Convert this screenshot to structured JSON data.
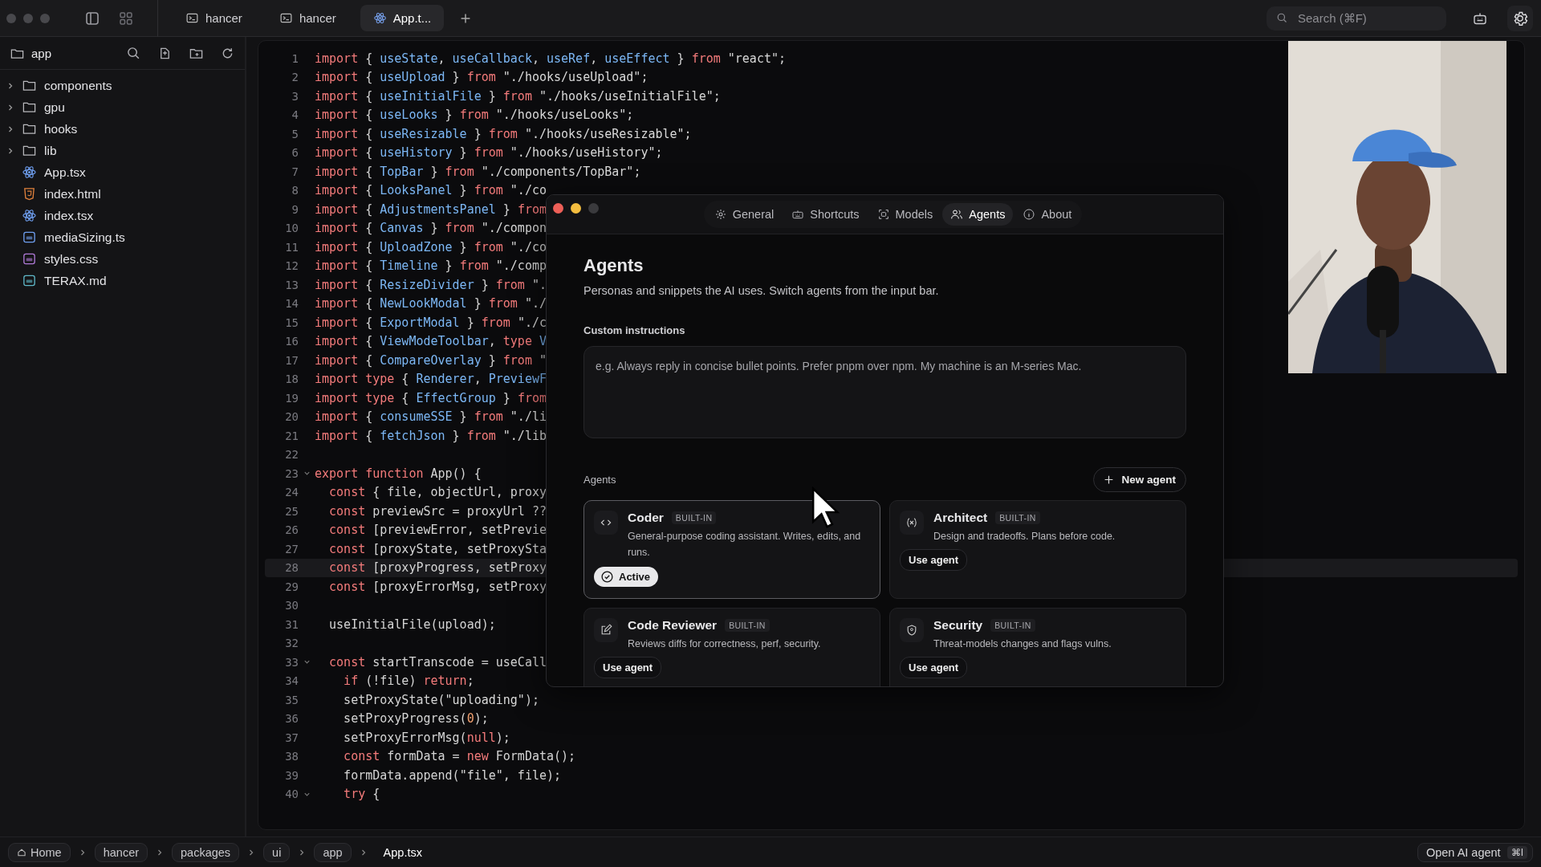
{
  "window": {
    "tabs": [
      {
        "label": "hancer",
        "kind": "terminal",
        "selected": false
      },
      {
        "label": "hancer",
        "kind": "terminal",
        "selected": false
      },
      {
        "label": "App.t...",
        "kind": "react",
        "selected": true
      }
    ],
    "search": {
      "placeholder": "Search (⌘F)"
    }
  },
  "sidebar": {
    "title": "app",
    "items": [
      {
        "name": "components",
        "kind": "folder",
        "expanded": false
      },
      {
        "name": "gpu",
        "kind": "folder",
        "expanded": false
      },
      {
        "name": "hooks",
        "kind": "folder",
        "expanded": false
      },
      {
        "name": "lib",
        "kind": "folder",
        "expanded": false
      },
      {
        "name": "App.tsx",
        "kind": "react"
      },
      {
        "name": "index.html",
        "kind": "html"
      },
      {
        "name": "index.tsx",
        "kind": "react"
      },
      {
        "name": "mediaSizing.ts",
        "kind": "ts"
      },
      {
        "name": "styles.css",
        "kind": "css"
      },
      {
        "name": "TERAX.md",
        "kind": "md"
      }
    ]
  },
  "editor": {
    "lines": [
      {
        "n": "1",
        "fold": false,
        "current": false,
        "seg": [
          {
            "keyword": "import"
          },
          {
            "plain": " { "
          },
          {
            "name": "useState"
          },
          {
            "plain": ", "
          },
          {
            "name": "useCallback"
          },
          {
            "plain": ", "
          },
          {
            "name": "useRef"
          },
          {
            "plain": ", "
          },
          {
            "name": "useEffect"
          },
          {
            "plain": " } "
          },
          {
            "keyword": "from "
          },
          {
            "string": "\"react\""
          },
          {
            "plain": ";"
          }
        ]
      },
      {
        "n": "2",
        "fold": false,
        "current": false,
        "seg": [
          {
            "keyword": "import"
          },
          {
            "plain": " { "
          },
          {
            "name": "useUpload"
          },
          {
            "plain": " } "
          },
          {
            "keyword": "from "
          },
          {
            "string": "\"./hooks/useUpload\""
          },
          {
            "plain": ";"
          }
        ]
      },
      {
        "n": "3",
        "fold": false,
        "current": false,
        "seg": [
          {
            "keyword": "import"
          },
          {
            "plain": " { "
          },
          {
            "name": "useInitialFile"
          },
          {
            "plain": " } "
          },
          {
            "keyword": "from "
          },
          {
            "string": "\"./hooks/useInitialFile\""
          },
          {
            "plain": ";"
          }
        ]
      },
      {
        "n": "4",
        "fold": false,
        "current": false,
        "seg": [
          {
            "keyword": "import"
          },
          {
            "plain": " { "
          },
          {
            "name": "useLooks"
          },
          {
            "plain": " } "
          },
          {
            "keyword": "from "
          },
          {
            "string": "\"./hooks/useLooks\""
          },
          {
            "plain": ";"
          }
        ]
      },
      {
        "n": "5",
        "fold": false,
        "current": false,
        "seg": [
          {
            "keyword": "import"
          },
          {
            "plain": " { "
          },
          {
            "name": "useResizable"
          },
          {
            "plain": " } "
          },
          {
            "keyword": "from "
          },
          {
            "string": "\"./hooks/useResizable\""
          },
          {
            "plain": ";"
          }
        ]
      },
      {
        "n": "6",
        "fold": false,
        "current": false,
        "seg": [
          {
            "keyword": "import"
          },
          {
            "plain": " { "
          },
          {
            "name": "useHistory"
          },
          {
            "plain": " } "
          },
          {
            "keyword": "from "
          },
          {
            "string": "\"./hooks/useHistory\""
          },
          {
            "plain": ";"
          }
        ]
      },
      {
        "n": "7",
        "fold": false,
        "current": false,
        "seg": [
          {
            "keyword": "import"
          },
          {
            "plain": " { "
          },
          {
            "name": "TopBar"
          },
          {
            "plain": " } "
          },
          {
            "keyword": "from "
          },
          {
            "string": "\"./components/TopBar\""
          },
          {
            "plain": ";"
          }
        ]
      },
      {
        "n": "8",
        "fold": false,
        "current": false,
        "seg": [
          {
            "keyword": "import"
          },
          {
            "plain": " { "
          },
          {
            "name": "LooksPanel"
          },
          {
            "plain": " } "
          },
          {
            "keyword": "from "
          },
          {
            "string": "\"./co"
          }
        ]
      },
      {
        "n": "9",
        "fold": false,
        "current": false,
        "seg": [
          {
            "keyword": "import"
          },
          {
            "plain": " { "
          },
          {
            "name": "AdjustmentsPanel"
          },
          {
            "plain": " } "
          },
          {
            "keyword": "from"
          }
        ]
      },
      {
        "n": "10",
        "fold": false,
        "current": false,
        "seg": [
          {
            "keyword": "import"
          },
          {
            "plain": " { "
          },
          {
            "name": "Canvas"
          },
          {
            "plain": " } "
          },
          {
            "keyword": "from "
          },
          {
            "string": "\"./compon"
          }
        ]
      },
      {
        "n": "11",
        "fold": false,
        "current": false,
        "seg": [
          {
            "keyword": "import"
          },
          {
            "plain": " { "
          },
          {
            "name": "UploadZone"
          },
          {
            "plain": " } "
          },
          {
            "keyword": "from "
          },
          {
            "string": "\"./co"
          }
        ]
      },
      {
        "n": "12",
        "fold": false,
        "current": false,
        "seg": [
          {
            "keyword": "import"
          },
          {
            "plain": " { "
          },
          {
            "name": "Timeline"
          },
          {
            "plain": " } "
          },
          {
            "keyword": "from "
          },
          {
            "string": "\"./comp"
          }
        ]
      },
      {
        "n": "13",
        "fold": false,
        "current": false,
        "seg": [
          {
            "keyword": "import"
          },
          {
            "plain": " { "
          },
          {
            "name": "ResizeDivider"
          },
          {
            "plain": " } "
          },
          {
            "keyword": "from "
          },
          {
            "string": "\"."
          }
        ]
      },
      {
        "n": "14",
        "fold": false,
        "current": false,
        "seg": [
          {
            "keyword": "import"
          },
          {
            "plain": " { "
          },
          {
            "name": "NewLookModal"
          },
          {
            "plain": " } "
          },
          {
            "keyword": "from "
          },
          {
            "string": "\"./"
          }
        ]
      },
      {
        "n": "15",
        "fold": false,
        "current": false,
        "seg": [
          {
            "keyword": "import"
          },
          {
            "plain": " { "
          },
          {
            "name": "ExportModal"
          },
          {
            "plain": " } "
          },
          {
            "keyword": "from "
          },
          {
            "string": "\"./c"
          }
        ]
      },
      {
        "n": "16",
        "fold": false,
        "current": false,
        "seg": [
          {
            "keyword": "import"
          },
          {
            "plain": " { "
          },
          {
            "name": "ViewModeToolbar"
          },
          {
            "plain": ", "
          },
          {
            "keyword": "type "
          },
          {
            "name": "V"
          }
        ]
      },
      {
        "n": "17",
        "fold": false,
        "current": false,
        "seg": [
          {
            "keyword": "import"
          },
          {
            "plain": " { "
          },
          {
            "name": "CompareOverlay"
          },
          {
            "plain": " } "
          },
          {
            "keyword": "from "
          },
          {
            "string": "\""
          }
        ]
      },
      {
        "n": "18",
        "fold": false,
        "current": false,
        "seg": [
          {
            "keyword": "import type"
          },
          {
            "plain": " { "
          },
          {
            "name": "Renderer"
          },
          {
            "plain": ", "
          },
          {
            "name": "PreviewF"
          }
        ]
      },
      {
        "n": "19",
        "fold": false,
        "current": false,
        "seg": [
          {
            "keyword": "import type"
          },
          {
            "plain": " { "
          },
          {
            "name": "EffectGroup"
          },
          {
            "plain": " } "
          },
          {
            "keyword": "from"
          }
        ]
      },
      {
        "n": "20",
        "fold": false,
        "current": false,
        "seg": [
          {
            "keyword": "import"
          },
          {
            "plain": " { "
          },
          {
            "name": "consumeSSE"
          },
          {
            "plain": " } "
          },
          {
            "keyword": "from "
          },
          {
            "string": "\"./li"
          }
        ]
      },
      {
        "n": "21",
        "fold": false,
        "current": false,
        "seg": [
          {
            "keyword": "import"
          },
          {
            "plain": " { "
          },
          {
            "name": "fetchJson"
          },
          {
            "plain": " } "
          },
          {
            "keyword": "from "
          },
          {
            "string": "\"./lib"
          }
        ]
      },
      {
        "n": "22",
        "fold": false,
        "current": false
      },
      {
        "n": "23",
        "fold": true,
        "current": false,
        "seg": [
          {
            "keyword": "export function"
          },
          {
            "plain": " App() {"
          }
        ]
      },
      {
        "n": "24",
        "fold": false,
        "current": false,
        "seg": [
          {
            "keyword": "  const"
          },
          {
            "plain": " { file, objectUrl, proxy"
          }
        ]
      },
      {
        "n": "25",
        "fold": false,
        "current": false,
        "seg": [
          {
            "keyword": "  const"
          },
          {
            "plain": " previewSrc = proxyUrl ??"
          }
        ]
      },
      {
        "n": "26",
        "fold": false,
        "current": false,
        "seg": [
          {
            "keyword": "  const"
          },
          {
            "plain": " [previewError, setPrevie"
          }
        ]
      },
      {
        "n": "27",
        "fold": false,
        "current": false,
        "seg": [
          {
            "keyword": "  const"
          },
          {
            "plain": " [proxyState, setProxySta"
          }
        ]
      },
      {
        "n": "28",
        "fold": false,
        "current": true,
        "seg": [
          {
            "keyword": "  const"
          },
          {
            "plain": " [proxyProgress, setProxy"
          }
        ]
      },
      {
        "n": "29",
        "fold": false,
        "current": false,
        "seg": [
          {
            "keyword": "  const"
          },
          {
            "plain": " [proxyErrorMsg, setProxy"
          }
        ]
      },
      {
        "n": "30",
        "fold": false,
        "current": false
      },
      {
        "n": "31",
        "fold": false,
        "current": false,
        "seg": [
          {
            "plain": "  useInitialFile(upload);"
          }
        ]
      },
      {
        "n": "32",
        "fold": false,
        "current": false
      },
      {
        "n": "33",
        "fold": true,
        "current": false,
        "seg": [
          {
            "keyword": "  const"
          },
          {
            "plain": " startTranscode = useCall"
          }
        ]
      },
      {
        "n": "34",
        "fold": false,
        "current": false,
        "seg": [
          {
            "keyword": "    if"
          },
          {
            "plain": " (!file) "
          },
          {
            "keyword": "return"
          },
          {
            "plain": ";"
          }
        ]
      },
      {
        "n": "35",
        "fold": false,
        "current": false,
        "seg": [
          {
            "plain": "    setProxyState("
          },
          {
            "string": "\"uploading\""
          },
          {
            "plain": ");"
          }
        ]
      },
      {
        "n": "36",
        "fold": false,
        "current": false,
        "seg": [
          {
            "plain": "    setProxyProgress("
          },
          {
            "number": "0"
          },
          {
            "plain": ");"
          }
        ]
      },
      {
        "n": "37",
        "fold": false,
        "current": false,
        "seg": [
          {
            "plain": "    setProxyErrorMsg("
          },
          {
            "keyword": "null"
          },
          {
            "plain": ");"
          }
        ]
      },
      {
        "n": "38",
        "fold": false,
        "current": false,
        "seg": [
          {
            "keyword": "    const"
          },
          {
            "plain": " formData = "
          },
          {
            "keyword": "new"
          },
          {
            "plain": " FormData();"
          }
        ]
      },
      {
        "n": "39",
        "fold": false,
        "current": false,
        "seg": [
          {
            "plain": "    formData.append("
          },
          {
            "string": "\"file\""
          },
          {
            "plain": ", file);"
          }
        ]
      },
      {
        "n": "40",
        "fold": true,
        "current": false,
        "seg": [
          {
            "keyword": "    try"
          },
          {
            "plain": " {"
          }
        ]
      }
    ]
  },
  "settings": {
    "tabs": [
      {
        "label": "General",
        "kind": "gear",
        "selected": false
      },
      {
        "label": "Shortcuts",
        "kind": "keyboard",
        "selected": false
      },
      {
        "label": "Models",
        "kind": "chip",
        "selected": false
      },
      {
        "label": "Agents",
        "kind": "people",
        "selected": true
      },
      {
        "label": "About",
        "kind": "info",
        "selected": false
      }
    ],
    "title": "Agents",
    "description": "Personas and snippets the AI uses. Switch agents from the input bar.",
    "instructions_label": "Custom instructions",
    "instructions_placeholder": "e.g. Always reply in concise bullet points. Prefer pnpm over npm. My machine is an M-series Mac.",
    "agents_label": "Agents",
    "new_agent": "New agent",
    "agents": [
      {
        "name": "Coder",
        "badge": "BUILT-IN",
        "description": "General-purpose coding assistant. Writes, edits, and runs.",
        "kind": "code",
        "active": true,
        "button": "Active"
      },
      {
        "name": "Architect",
        "badge": "BUILT-IN",
        "description": "Design and tradeoffs. Plans before code.",
        "kind": "variable",
        "active": false,
        "button": "Use agent"
      },
      {
        "name": "Code Reviewer",
        "badge": "BUILT-IN",
        "description": "Reviews diffs for correctness, perf, security.",
        "kind": "edit",
        "active": false,
        "button": "Use agent"
      },
      {
        "name": "Security",
        "badge": "BUILT-IN",
        "description": "Threat-models changes and flags vulns.",
        "kind": "shield",
        "active": false,
        "button": "Use agent"
      }
    ]
  },
  "status_bar": {
    "breadcrumbs": [
      "Home",
      "hancer",
      "packages",
      "ui",
      "app",
      "App.tsx"
    ],
    "agent_button": "Open AI agent",
    "shortcut": "⌘I"
  }
}
